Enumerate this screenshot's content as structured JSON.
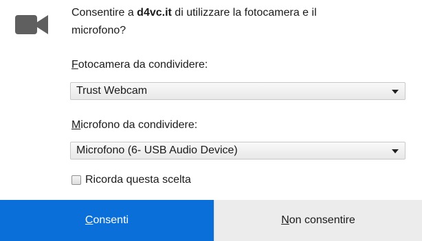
{
  "prompt": {
    "prefix": "Consentire a ",
    "site": "d4vc.it",
    "suffix_line1": " di utilizzare la fotocamera e il",
    "suffix_line2": "microfono?"
  },
  "camera": {
    "label_accesskey": "F",
    "label_rest": "otocamera da condividere:",
    "selected": "Trust Webcam"
  },
  "microphone": {
    "label_accesskey": "M",
    "label_rest": "icrofono da condividere:",
    "selected": "Microfono (6- USB Audio Device)"
  },
  "remember": {
    "label": "Ricorda questa scelta",
    "checked": false
  },
  "buttons": {
    "allow_accesskey": "C",
    "allow_rest": "onsenti",
    "deny_accesskey": "N",
    "deny_rest": "on consentire"
  },
  "colors": {
    "allow_bg": "#0a6fd8",
    "deny_bg": "#ececec",
    "icon": "#5f5f5f"
  },
  "icons": {
    "header": "video-camera-icon"
  }
}
